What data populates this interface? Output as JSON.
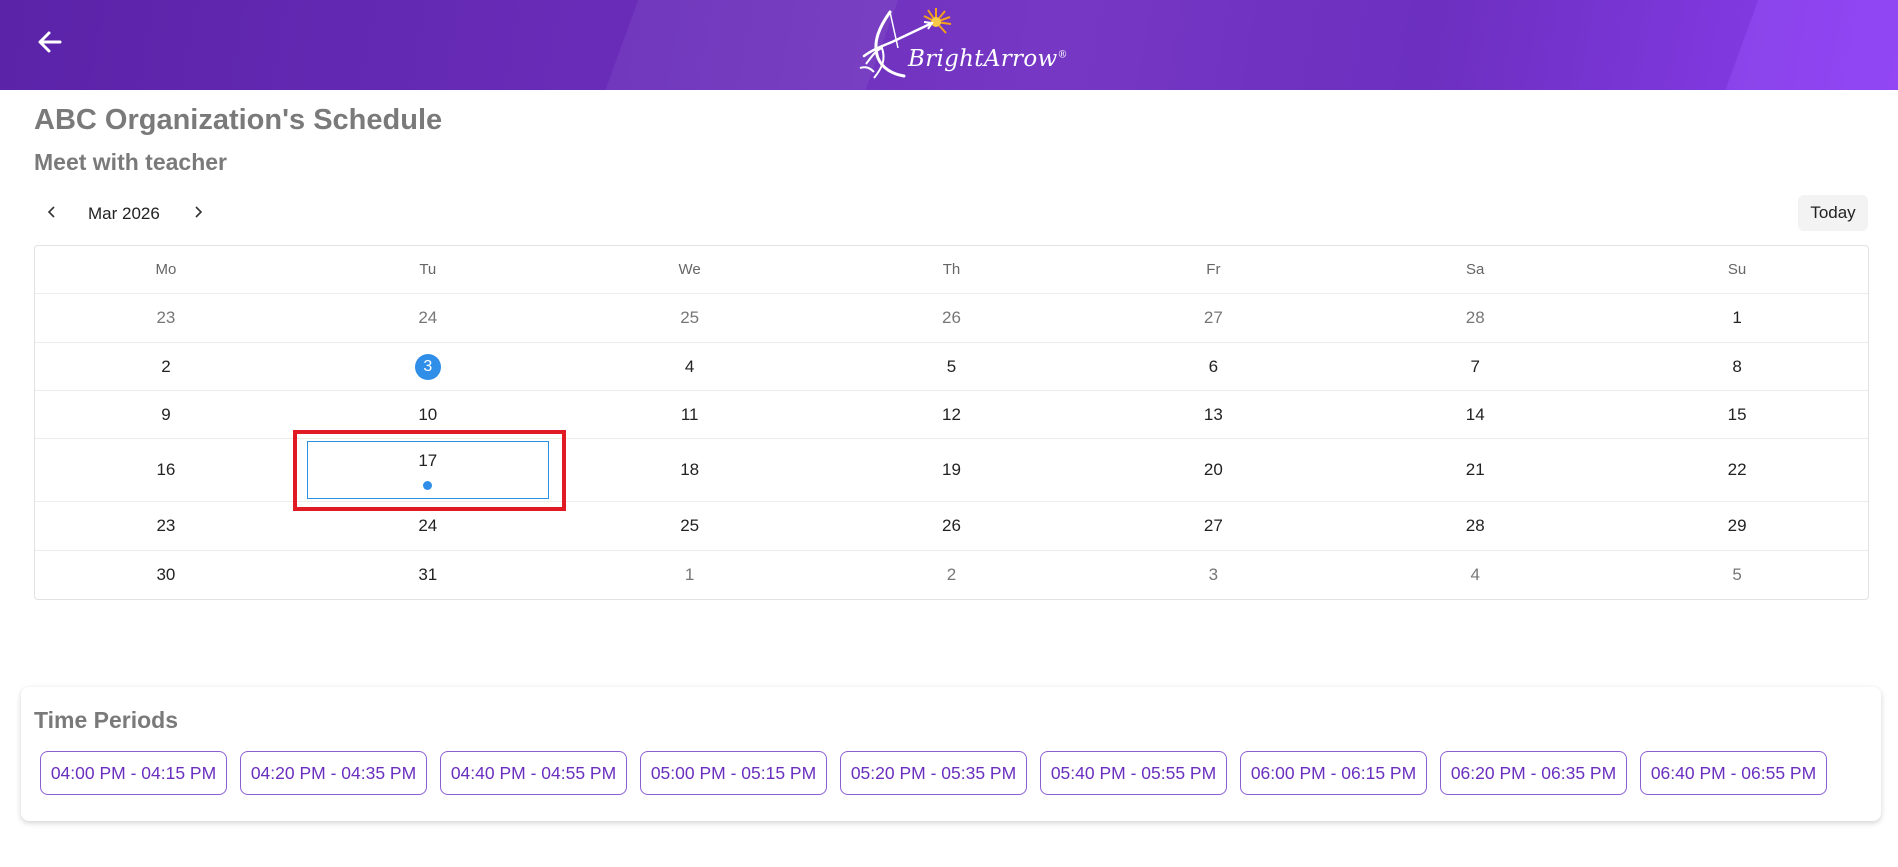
{
  "header": {
    "back_icon": "arrow-left-icon",
    "logo_text": "BrightArrow",
    "logo_mark": "®",
    "colors": {
      "primary": "#6a2dba",
      "accent": "#8a3df0"
    }
  },
  "page": {
    "org_title": "ABC Organization's Schedule",
    "subtitle": "Meet with teacher"
  },
  "calendar": {
    "prev_icon": "chevron-left-icon",
    "next_icon": "chevron-right-icon",
    "month_label": "Mar 2026",
    "today_label": "Today",
    "weekdays": [
      "Mo",
      "Tu",
      "We",
      "Th",
      "Fr",
      "Sa",
      "Su"
    ],
    "weeks": [
      [
        "23",
        "24",
        "25",
        "26",
        "27",
        "28",
        "1"
      ],
      [
        "2",
        "3",
        "4",
        "5",
        "6",
        "7",
        "8"
      ],
      [
        "9",
        "10",
        "11",
        "12",
        "13",
        "14",
        "15"
      ],
      [
        "16",
        "17",
        "18",
        "19",
        "20",
        "21",
        "22"
      ],
      [
        "23",
        "24",
        "25",
        "26",
        "27",
        "28",
        "29"
      ],
      [
        "30",
        "31",
        "1",
        "2",
        "3",
        "4",
        "5"
      ]
    ],
    "today_date": "3",
    "selected_date": "17",
    "highlight_color": "#2f8fe8"
  },
  "periods": {
    "title": "Time Periods",
    "slots": [
      "04:00 PM - 04:15 PM",
      "04:20 PM - 04:35 PM",
      "04:40 PM - 04:55 PM",
      "05:00 PM - 05:15 PM",
      "05:20 PM - 05:35 PM",
      "05:40 PM - 05:55 PM",
      "06:00 PM - 06:15 PM",
      "06:20 PM - 06:35 PM",
      "06:40 PM - 06:55 PM"
    ]
  }
}
